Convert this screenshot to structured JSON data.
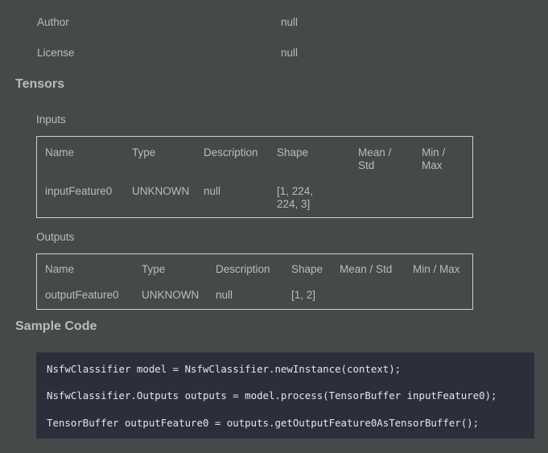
{
  "model_info": {
    "author_label": "Author",
    "author_value": "null",
    "license_label": "License",
    "license_value": "null"
  },
  "tensors": {
    "title": "Tensors",
    "inputs": {
      "title": "Inputs",
      "headers": [
        "Name",
        "Type",
        "Description",
        "Shape",
        "Mean / Std",
        "Min / Max"
      ],
      "row": {
        "name": "inputFeature0",
        "type": "UNKNOWN",
        "description": "null",
        "shape": "[1, 224, 224, 3]",
        "mean_std": "",
        "min_max": ""
      }
    },
    "outputs": {
      "title": "Outputs",
      "headers": [
        "Name",
        "Type",
        "Description",
        "Shape",
        "Mean / Std",
        "Min / Max"
      ],
      "row": {
        "name": "outputFeature0",
        "type": "UNKNOWN",
        "description": "null",
        "shape": "[1, 2]",
        "mean_std": "",
        "min_max": ""
      }
    }
  },
  "sample_code": {
    "title": "Sample Code",
    "lines": [
      "NsfwClassifier model = NsfwClassifier.newInstance(context);",
      "NsfwClassifier.Outputs outputs = model.process(TensorBuffer inputFeature0);",
      "TensorBuffer outputFeature0 = outputs.getOutputFeature0AsTensorBuffer();"
    ]
  }
}
